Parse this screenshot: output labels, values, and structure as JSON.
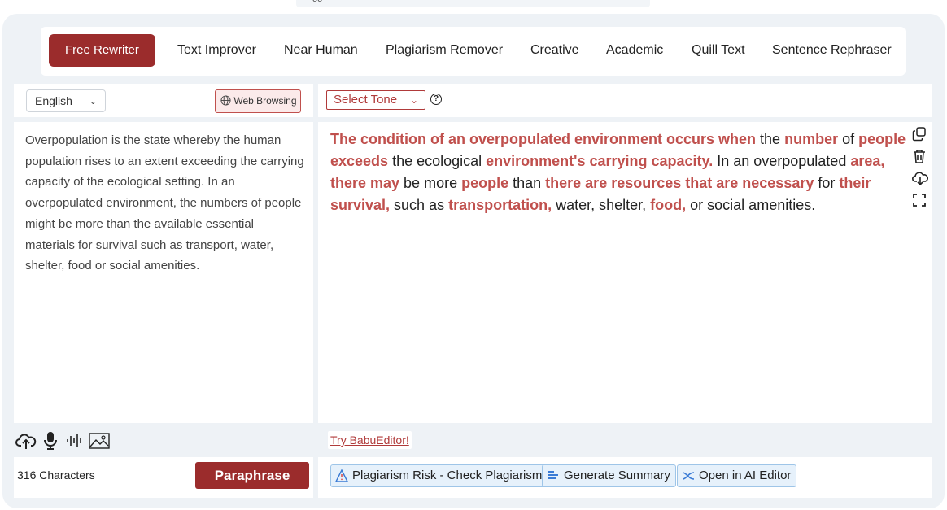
{
  "header": {
    "strip_text": "oo"
  },
  "modes": [
    {
      "label": "Free Rewriter",
      "active": true
    },
    {
      "label": "Text Improver"
    },
    {
      "label": "Near Human"
    },
    {
      "label": "Plagiarism Remover"
    },
    {
      "label": "Creative"
    },
    {
      "label": "Academic"
    },
    {
      "label": "Quill Text"
    },
    {
      "label": "Sentence Rephraser"
    }
  ],
  "input": {
    "language": "English",
    "web_browsing_label": "Web Browsing",
    "text": "Overpopulation is the state whereby the human population rises to an extent exceeding the carrying capacity of the ecological setting. In an overpopulated environment, the numbers of people might be more than the available essential materials for survival such as transport, water, shelter, food or social amenities.",
    "char_count": "316 Characters",
    "paraphrase_label": "Paraphrase"
  },
  "output": {
    "tone_label": "Select Tone",
    "segments": [
      {
        "t": "The condition of an overpopulated environment occurs when",
        "h": true
      },
      {
        "t": " the ",
        "h": false
      },
      {
        "t": "number",
        "h": true
      },
      {
        "t": " of ",
        "h": false
      },
      {
        "t": "people exceeds",
        "h": true
      },
      {
        "t": " the ecological ",
        "h": false
      },
      {
        "t": "environment's carrying capacity.",
        "h": true
      },
      {
        "t": " In an overpopulated ",
        "h": false
      },
      {
        "t": "area, there may",
        "h": true
      },
      {
        "t": " be more ",
        "h": false
      },
      {
        "t": "people",
        "h": true
      },
      {
        "t": " than ",
        "h": false
      },
      {
        "t": "there are resources that are necessary",
        "h": true
      },
      {
        "t": " for ",
        "h": false
      },
      {
        "t": "their survival,",
        "h": true
      },
      {
        "t": " such as ",
        "h": false
      },
      {
        "t": "transportation,",
        "h": true
      },
      {
        "t": " water, shelter, ",
        "h": false
      },
      {
        "t": "food,",
        "h": true
      },
      {
        "t": " or social amenities.",
        "h": false
      }
    ],
    "try_editor_label": "Try BabuEditor!",
    "actions": [
      {
        "label": "Plagiarism Risk - Check Plagiarism",
        "icon": "warning-icon"
      },
      {
        "label": "Generate Summary",
        "icon": "summary-icon"
      },
      {
        "label": "Open in AI Editor",
        "icon": "ai-editor-icon"
      }
    ]
  },
  "colors": {
    "accent": "#9b2c2c",
    "highlight": "#c0504d",
    "panel_bg": "#eef2f6"
  }
}
